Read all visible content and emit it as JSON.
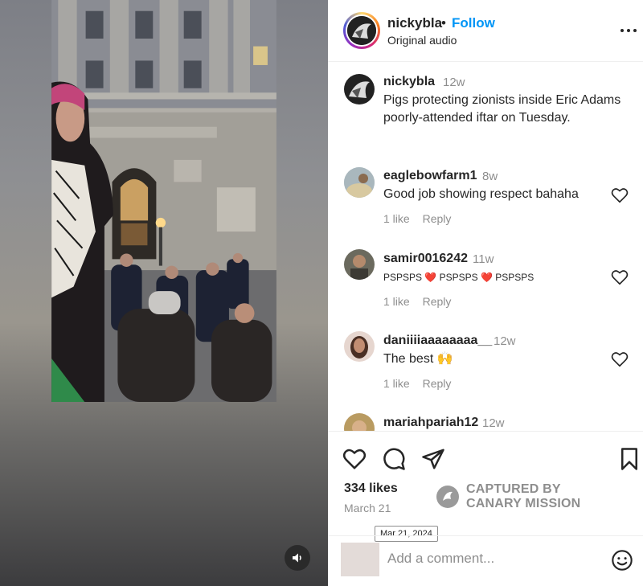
{
  "header": {
    "username": "nickybla",
    "separator": "•",
    "follow_label": "Follow",
    "audio_label": "Original audio"
  },
  "caption": {
    "username": "nickybla",
    "time": "12w",
    "text": "Pigs protecting zionists inside Eric Adams poorly-attended iftar on Tuesday."
  },
  "comments": [
    {
      "username": "eaglebowfarm1",
      "time": "8w",
      "text": "Good job showing respect bahaha",
      "likes": "1 like",
      "reply": "Reply"
    },
    {
      "username": "samir0016242",
      "time": "11w",
      "text": "PSPSPS ❤️ PSPSPS ❤️ PSPSPS",
      "likes": "1 like",
      "reply": "Reply"
    },
    {
      "username": "daniiiiaaaaaaaa__",
      "time": "12w",
      "text": "The best 🙌",
      "likes": "1 like",
      "reply": "Reply"
    },
    {
      "username": "mariahpariah12",
      "time": "12w"
    }
  ],
  "actions": {
    "likes": "334 likes",
    "date": "March 21",
    "date_tooltip": "Mar 21, 2024"
  },
  "watermark": {
    "line1": "CAPTURED BY",
    "line2": "CANARY MISSION"
  },
  "add_comment": {
    "placeholder": "Add a comment..."
  },
  "icons": {
    "more": "more-options-icon",
    "like": "heart-icon",
    "comment": "comment-icon",
    "share": "share-icon",
    "save": "bookmark-icon",
    "emoji": "emoji-icon",
    "sound": "speaker-icon"
  },
  "colors": {
    "follow_blue": "#0095f6",
    "secondary_text": "#8e8e8e",
    "heart_red": "#e0245e"
  }
}
